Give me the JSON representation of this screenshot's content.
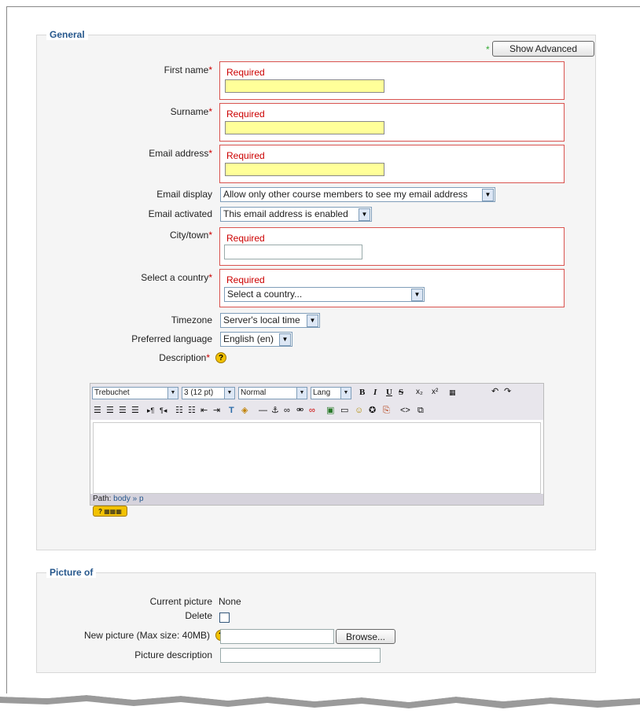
{
  "general": {
    "legend": "General",
    "show_advanced": "Show Advanced",
    "required_text": "Required",
    "fields": {
      "first_name": "First name",
      "surname": "Surname",
      "email_address": "Email address",
      "email_display": "Email display",
      "email_display_value": "Allow only other course members to see my email address",
      "email_activated": "Email activated",
      "email_activated_value": "This email address is enabled",
      "city": "City/town",
      "country": "Select a country",
      "country_placeholder": "Select a country...",
      "timezone": "Timezone",
      "timezone_value": "Server's local time",
      "language": "Preferred language",
      "language_value": "English (en)",
      "description": "Description"
    },
    "required_star": "*"
  },
  "editor": {
    "font": "Trebuchet",
    "size": "3 (12 pt)",
    "format": "Normal",
    "lang": "Lang",
    "path_label": "Path:",
    "path_value": "body » p"
  },
  "picture": {
    "legend": "Picture of",
    "current_picture_label": "Current picture",
    "current_picture_value": "None",
    "delete_label": "Delete",
    "new_picture_label": "New picture (Max size: 40MB)",
    "browse": "Browse...",
    "picture_description_label": "Picture description"
  }
}
